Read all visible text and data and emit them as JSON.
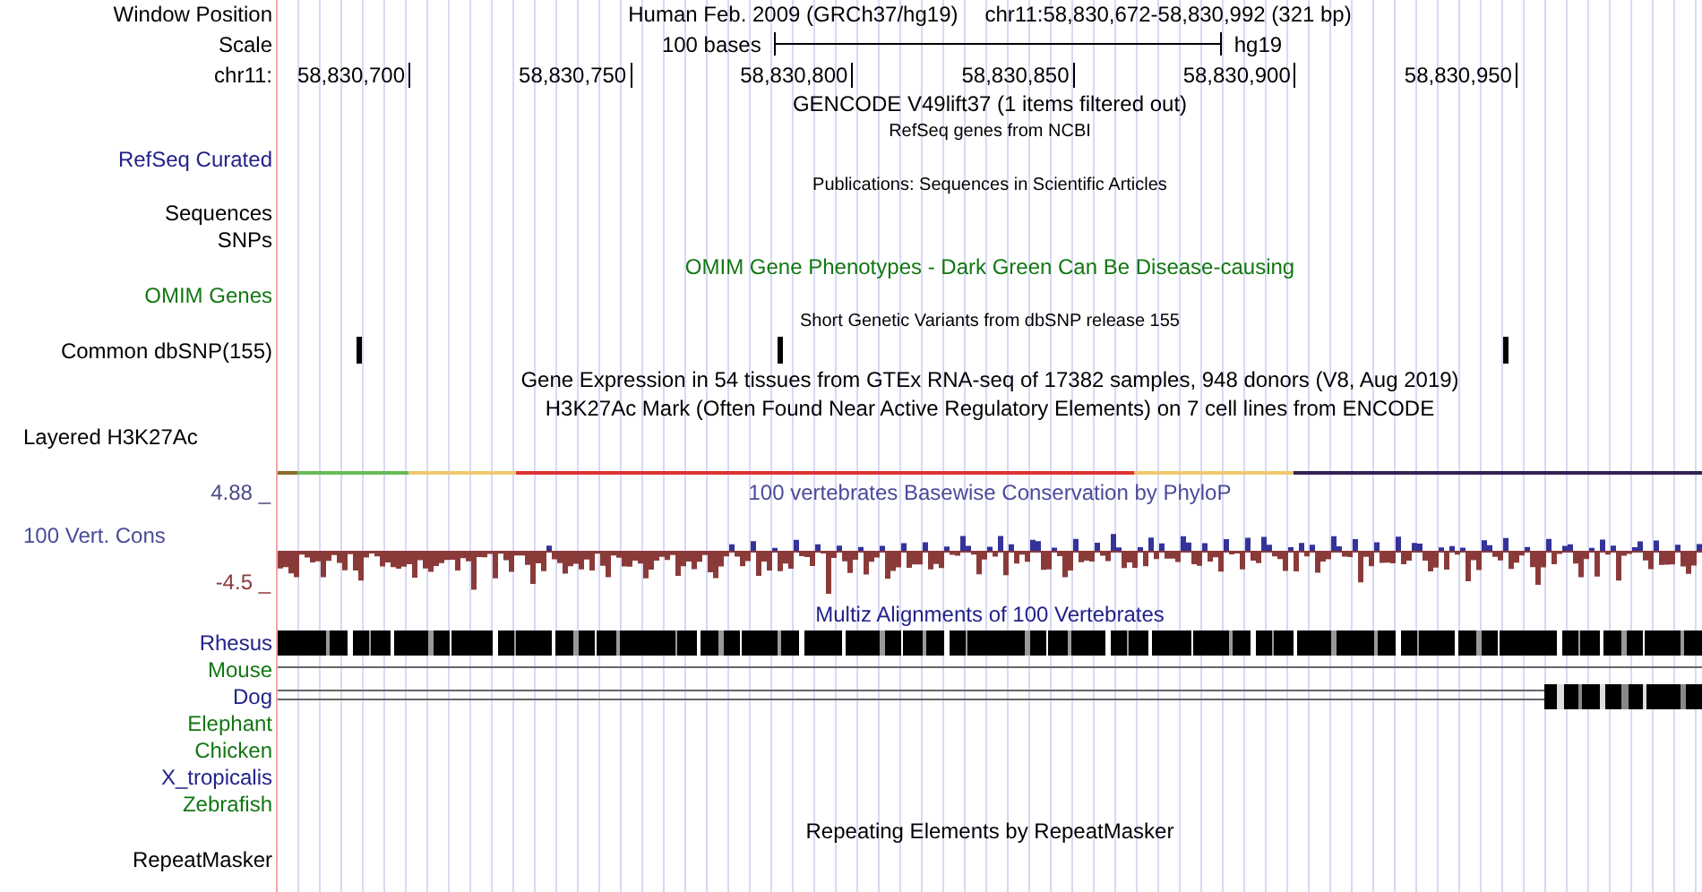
{
  "header": {
    "position_label": "Window Position",
    "assembly": "Human Feb. 2009 (GRCh37/hg19)",
    "position": "chr11:58,830,672-58,830,992 (321 bp)",
    "scale_label": "Scale",
    "scale_text": "100 bases",
    "scale_db": "hg19",
    "chrom_label": "chr11:",
    "ruler_ticks": [
      "58,830,700",
      "58,830,750",
      "58,830,800",
      "58,830,850",
      "58,830,900",
      "58,830,950"
    ]
  },
  "rows": [
    {
      "kind": "title",
      "title": "GENCODE V49lift37 (1 items filtered out)"
    },
    {
      "kind": "small_title",
      "title": "RefSeq genes from NCBI"
    },
    {
      "kind": "label",
      "label": "RefSeq Curated",
      "color": "#22228a"
    },
    {
      "kind": "small_title",
      "title": "Publications: Sequences in Scientific Articles"
    },
    {
      "kind": "label",
      "label": "Sequences",
      "color": "#000000"
    },
    {
      "kind": "label",
      "label": "SNPs",
      "color": "#000000"
    },
    {
      "kind": "title",
      "title": "OMIM Gene Phenotypes - Dark Green Can Be Disease-causing",
      "color": "#117711"
    },
    {
      "kind": "label",
      "label": "OMIM Genes",
      "color": "#117711"
    },
    {
      "kind": "small_title",
      "title": "Short Genetic Variants from dbSNP release 155"
    },
    {
      "kind": "snp",
      "label": "Common dbSNP(155)",
      "color": "#000000"
    },
    {
      "kind": "title",
      "title": "Gene Expression in 54 tissues from GTEx RNA-seq of 17382 samples, 948 donors (V8, Aug 2019)"
    },
    {
      "kind": "title",
      "title": "H3K27Ac Mark (Often Found Near Active Regulatory Elements) on 7 cell lines from ENCODE"
    },
    {
      "kind": "group_label",
      "label": "Layered H3K27Ac"
    },
    {
      "kind": "color_bar"
    },
    {
      "kind": "conservation",
      "label": "100 Vert. Cons",
      "title": "100 vertebrates Basewise Conservation by PhyloP",
      "max": "4.88 _",
      "min": "-4.5 _"
    },
    {
      "kind": "title",
      "title": "Multiz Alignments of 100 Vertebrates",
      "color": "#22228a"
    },
    {
      "kind": "species_blocks",
      "label": "Rhesus",
      "color": "#22228a"
    },
    {
      "kind": "species_line",
      "label": "Mouse",
      "color": "#117711"
    },
    {
      "kind": "species_double_line",
      "label": "Dog",
      "color": "#22228a"
    },
    {
      "kind": "species",
      "label": "Elephant",
      "color": "#117711"
    },
    {
      "kind": "species",
      "label": "Chicken",
      "color": "#117711"
    },
    {
      "kind": "species",
      "label": "X_tropicalis",
      "color": "#22228a"
    },
    {
      "kind": "species",
      "label": "Zebrafish",
      "color": "#117711"
    },
    {
      "kind": "title",
      "title": "Repeating Elements by RepeatMasker"
    },
    {
      "kind": "label",
      "label": "RepeatMasker",
      "color": "#000000"
    }
  ]
}
